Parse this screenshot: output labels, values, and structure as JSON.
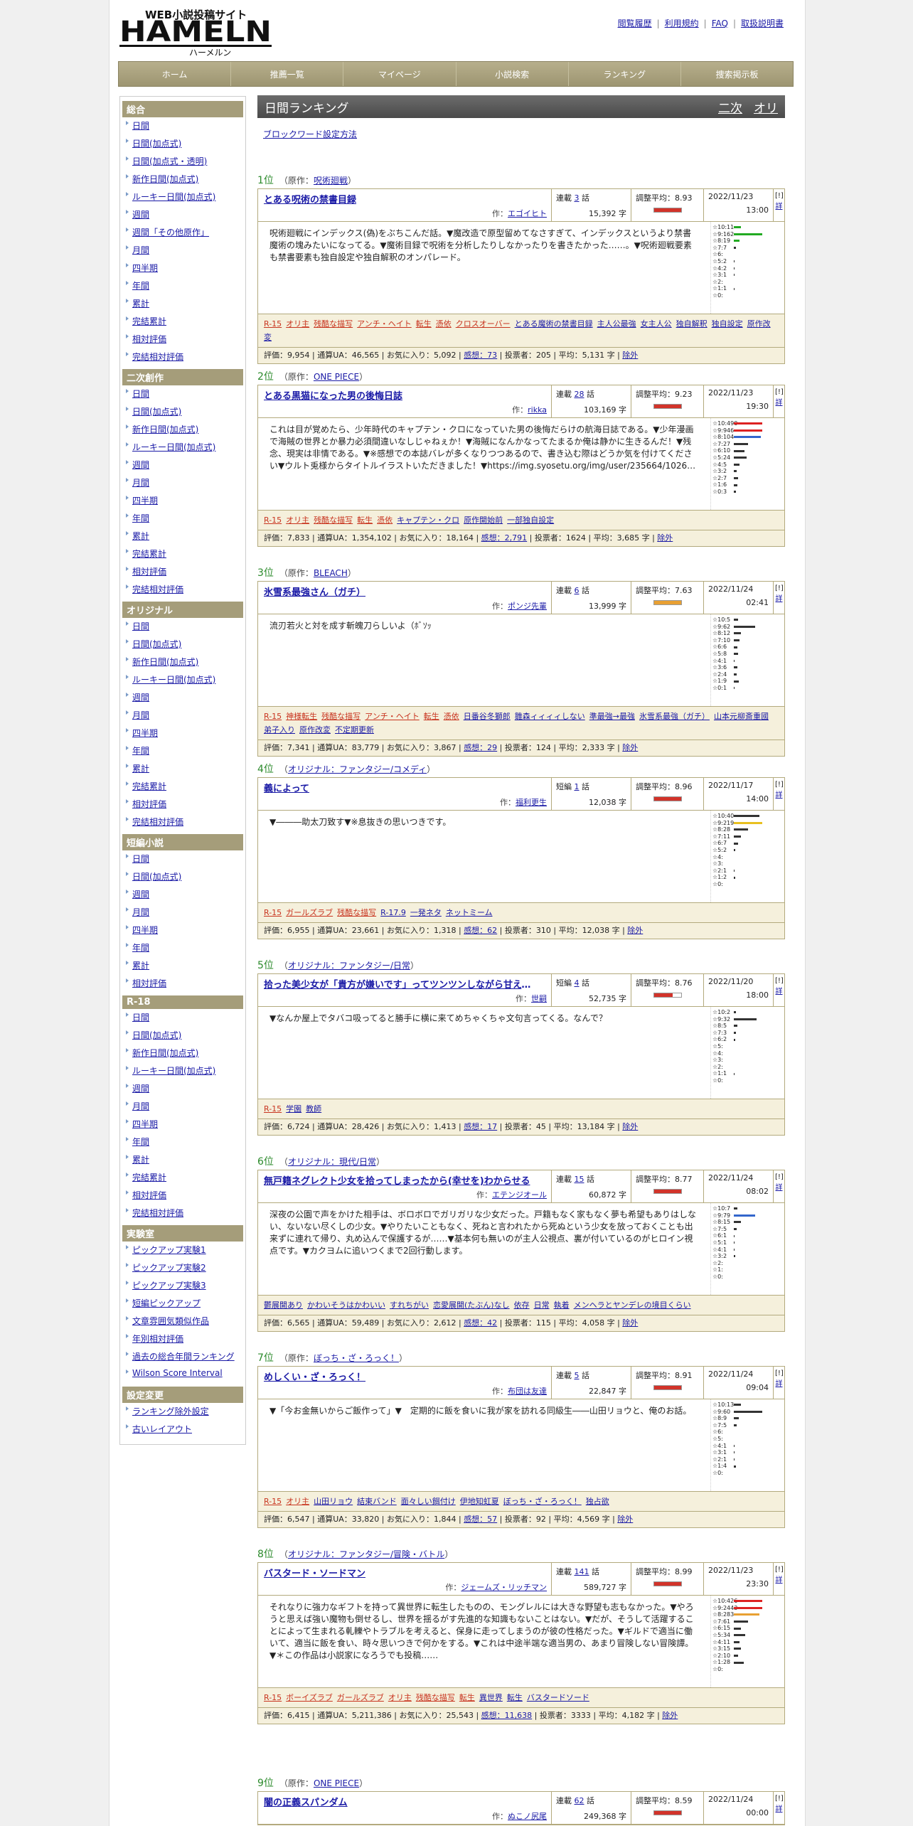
{
  "header": {
    "logo_text": "HAMELN",
    "logo_sub": "WEB小説投稿サイト",
    "logo_kana": "ハーメルン",
    "links": [
      "閲覧履歴",
      "利用規約",
      "FAQ",
      "取扱説明書"
    ]
  },
  "nav": [
    "ホーム",
    "推薦一覧",
    "マイページ",
    "小説検索",
    "ランキング",
    "捜索掲示板"
  ],
  "sidebar": [
    {
      "head": "総合",
      "items": [
        "日間",
        "日間(加点式)",
        "日間(加点式・透明)",
        "新作日間(加点式)",
        "ルーキー日間(加点式)",
        "週間",
        "週間「その他原作」",
        "月間",
        "四半期",
        "年間",
        "累計",
        "完結累計",
        "相対評価",
        "完結相対評価"
      ]
    },
    {
      "head": "二次創作",
      "items": [
        "日間",
        "日間(加点式)",
        "新作日間(加点式)",
        "ルーキー日間(加点式)",
        "週間",
        "月間",
        "四半期",
        "年間",
        "累計",
        "完結累計",
        "相対評価",
        "完結相対評価"
      ]
    },
    {
      "head": "オリジナル",
      "items": [
        "日間",
        "日間(加点式)",
        "新作日間(加点式)",
        "ルーキー日間(加点式)",
        "週間",
        "月間",
        "四半期",
        "年間",
        "累計",
        "完結累計",
        "相対評価",
        "完結相対評価"
      ]
    },
    {
      "head": "短編小説",
      "items": [
        "日間",
        "日間(加点式)",
        "週間",
        "月間",
        "四半期",
        "年間",
        "累計",
        "相対評価"
      ]
    },
    {
      "head": "R-18",
      "items": [
        "日間",
        "日間(加点式)",
        "新作日間(加点式)",
        "ルーキー日間(加点式)",
        "週間",
        "月間",
        "四半期",
        "年間",
        "累計",
        "完結累計",
        "相対評価",
        "完結相対評価"
      ]
    },
    {
      "head": "実験室",
      "items": [
        "ピックアップ実験1",
        "ピックアップ実験2",
        "ピックアップ実験3",
        "短編ピックアップ",
        "文章雰囲気類似作品",
        "年別相対評価",
        "過去の総合年間ランキング",
        "Wilson Score Interval"
      ]
    },
    {
      "head": "設定変更",
      "items": [
        "ランキング除外設定",
        "古いレイアウト"
      ]
    }
  ],
  "ranking": {
    "title": "日間ランキング",
    "tabs": [
      "二次",
      "オリ"
    ],
    "block_link": "ブロックワード設定方法",
    "entries": [
      {
        "rank": "1位",
        "src_prefix": "（原作：",
        "src": "呪術廻戦",
        "src_suffix": "）",
        "title": "とある呪術の禁書目録",
        "author": "エゴイヒト",
        "kind": "連載",
        "eps": "3",
        "chars": "15,392 字",
        "avg": "調整平均：8.93",
        "bar": "#d2332a",
        "bar_fill": 100,
        "date": "2022/11/23",
        "time": "13:00",
        "synopsis": "呪術廻戦にインデックス(偽)をぶちこんだ話。▼魔改造で原型留めてなさすぎて、インデックスというより禁書魔術の塊みたいになってる。▼魔術目録で呪術を分析したりしなかったりを書きたかった……。▼呪術廻戦要素も禁書要素も独自設定や独自解釈のオンパレード。",
        "dist": [
          [
            "☆10:11",
            10,
            "#2a2"
          ],
          [
            "☆9:162",
            40,
            "#2a2"
          ],
          [
            "☆8:19",
            8,
            "#2a2"
          ],
          [
            "☆7:7",
            3,
            "#333"
          ],
          [
            "☆6:",
            0,
            "#333"
          ],
          [
            "☆5:2",
            1,
            "#333"
          ],
          [
            "☆4:2",
            1,
            "#333"
          ],
          [
            "☆3:1",
            1,
            "#333"
          ],
          [
            "☆2:",
            0,
            "#333"
          ],
          [
            "☆1:1",
            1,
            "#333"
          ],
          [
            "☆0:",
            0,
            "#333"
          ]
        ],
        "tags": [
          [
            "R-15",
            1
          ],
          [
            "オリ主",
            1
          ],
          [
            "残酷な描写",
            1
          ],
          [
            "アンチ・ヘイト",
            1
          ],
          [
            "転生",
            1
          ],
          [
            "憑依",
            1
          ],
          [
            "クロスオーバー",
            1
          ],
          [
            "とある魔術の禁書目録",
            0
          ],
          [
            "主人公最強",
            0
          ],
          [
            "女主人公",
            0
          ],
          [
            "独自解釈",
            0
          ],
          [
            "独自設定",
            0
          ],
          [
            "原作改変",
            0
          ]
        ],
        "stats": [
          "評価：9,954",
          "通算UA：46,565",
          "お気に入り：5,092",
          "感想：73",
          "投票者：205",
          "平均：5,131 字",
          "除外"
        ]
      },
      {
        "rank": "2位",
        "src_prefix": "（原作：",
        "src": "ONE PIECE",
        "src_suffix": "）",
        "title": "とある黒猫になった男の後悔日誌",
        "author": "rikka",
        "kind": "連載",
        "eps": "28",
        "chars": "103,169 字",
        "avg": "調整平均：9.23",
        "bar": "#d2332a",
        "bar_fill": 100,
        "date": "2022/11/23",
        "time": "19:30",
        "synopsis": "これは目が覚めたら、少年時代のキャプテン・クロになっていた男の後悔だらけの航海日誌である。▼少年漫画で海賊の世界とか暴力必須間違いなしじゃねぇか！▼海賊になんかなってたまるか俺は静かに生きるんだ！▼残念、現実は非情である。▼※感想での本誌バレが多くなりつつあるので、書き込む際はどうか気を付けてください▼ウルト兎様からタイトルイラストいただきました！▼https://img.syosetu.org/img/user/235664/1026…",
        "dist": [
          [
            "☆10:490",
            40,
            "#d22"
          ],
          [
            "☆9:946",
            40,
            "#d22"
          ],
          [
            "☆8:104",
            38,
            "#36c"
          ],
          [
            "☆7:27",
            20,
            "#333"
          ],
          [
            "☆6:10",
            15,
            "#333"
          ],
          [
            "☆5:24",
            18,
            "#333"
          ],
          [
            "☆4:5",
            8,
            "#333"
          ],
          [
            "☆3:2",
            4,
            "#333"
          ],
          [
            "☆2:7",
            6,
            "#333"
          ],
          [
            "☆1:6",
            5,
            "#333"
          ],
          [
            "☆0:3",
            3,
            "#333"
          ]
        ],
        "tags": [
          [
            "R-15",
            1
          ],
          [
            "オリ主",
            1
          ],
          [
            "残酷な描写",
            1
          ],
          [
            "転生",
            1
          ],
          [
            "憑依",
            1
          ],
          [
            "キャプテン・クロ",
            0
          ],
          [
            "原作開始前",
            0
          ],
          [
            "一部独自設定",
            0
          ]
        ],
        "stats": [
          "評価：7,833",
          "通算UA：1,354,102",
          "お気に入り：18,164",
          "感想：2,791",
          "投票者：1624",
          "平均：3,685 字",
          "除外"
        ]
      },
      {
        "rank": "3位",
        "src_prefix": "（原作：",
        "src": "BLEACH",
        "src_suffix": "）",
        "title": "氷雪系最強さん（ガチ）",
        "author": "ポンジ先輩",
        "kind": "連載",
        "eps": "6",
        "chars": "13,999 字",
        "avg": "調整平均：7.63",
        "bar": "#e8a032",
        "bar_fill": 100,
        "date": "2022/11/24",
        "time": "02:41",
        "synopsis": "流刃若火と対を成す斬魄刀らしいよ（ﾎﾞｿｯ",
        "dist": [
          [
            "☆10:5",
            6,
            "#333"
          ],
          [
            "☆9:62",
            30,
            "#333"
          ],
          [
            "☆8:12",
            10,
            "#333"
          ],
          [
            "☆7:10",
            8,
            "#333"
          ],
          [
            "☆6:6",
            5,
            "#333"
          ],
          [
            "☆5:8",
            6,
            "#333"
          ],
          [
            "☆4:1",
            1,
            "#333"
          ],
          [
            "☆3:6",
            5,
            "#333"
          ],
          [
            "☆2:4",
            4,
            "#333"
          ],
          [
            "☆1:9",
            7,
            "#333"
          ],
          [
            "☆0:1",
            1,
            "#333"
          ]
        ],
        "tags": [
          [
            "R-15",
            1
          ],
          [
            "神様転生",
            1
          ],
          [
            "残酷な描写",
            1
          ],
          [
            "アンチ・ヘイト",
            1
          ],
          [
            "転生",
            1
          ],
          [
            "憑依",
            1
          ],
          [
            "日番谷冬獅郎",
            0
          ],
          [
            "雛森ィィィィしない",
            0
          ],
          [
            "準最強→最強",
            0
          ],
          [
            "氷雪系最強（ガチ）",
            0
          ],
          [
            "山本元柳斎重國",
            0
          ],
          [
            "弟子入り",
            0
          ],
          [
            "原作改変",
            0
          ],
          [
            "不定期更新",
            0
          ]
        ],
        "stats": [
          "評価：7,341",
          "通算UA：83,779",
          "お気に入り：3,867",
          "感想：29",
          "投票者：124",
          "平均：2,333 字",
          "除外"
        ]
      },
      {
        "rank": "4位",
        "src_prefix": "（",
        "src": "オリジナル：ファンタジー/コメディ",
        "src_suffix": "）",
        "title": "義によって",
        "author": "福利更生",
        "kind": "短編",
        "eps": "1",
        "chars": "12,038 字",
        "avg": "調整平均：8.96",
        "bar": "#d2332a",
        "bar_fill": 100,
        "date": "2022/11/17",
        "time": "14:00",
        "synopsis": "▼―――助太刀致す▼※息抜きの思いつきです。",
        "dist": [
          [
            "☆10:40",
            36,
            "#333"
          ],
          [
            "☆9:219",
            40,
            "#e8c020"
          ],
          [
            "☆8:28",
            20,
            "#333"
          ],
          [
            "☆7:11",
            10,
            "#333"
          ],
          [
            "☆6:7",
            6,
            "#333"
          ],
          [
            "☆5:2",
            2,
            "#333"
          ],
          [
            "☆4:",
            0,
            "#333"
          ],
          [
            "☆3:",
            0,
            "#333"
          ],
          [
            "☆2:1",
            1,
            "#333"
          ],
          [
            "☆1:2",
            2,
            "#333"
          ],
          [
            "☆0:",
            0,
            "#333"
          ]
        ],
        "tags": [
          [
            "R-15",
            1
          ],
          [
            "ガールズラブ",
            1
          ],
          [
            "残酷な描写",
            1
          ],
          [
            "R-17.9",
            0
          ],
          [
            "一発ネタ",
            0
          ],
          [
            "ネットミーム",
            0
          ]
        ],
        "stats": [
          "評価：6,955",
          "通算UA：23,661",
          "お気に入り：1,318",
          "感想：62",
          "投票者：310",
          "平均：12,038 字",
          "除外"
        ]
      },
      {
        "rank": "5位",
        "src_prefix": "（",
        "src": "オリジナル：ファンタジー/日常",
        "src_suffix": "）",
        "title": "拾った美少女が「貴方が嫌いです」ってツンツンしながら甘えてくる",
        "author": "世嗣",
        "kind": "短編",
        "eps": "4",
        "chars": "52,735 字",
        "avg": "調整平均：8.76",
        "bar": "#d2332a",
        "bar_fill": 70,
        "date": "2022/11/20",
        "time": "18:00",
        "synopsis": "▼なんか屋上でタバコ吸ってると勝手に横に来てめちゃくちゃ文句言ってくる。なんで？",
        "dist": [
          [
            "☆10:2",
            3,
            "#333"
          ],
          [
            "☆9:32",
            32,
            "#333"
          ],
          [
            "☆8:5",
            5,
            "#333"
          ],
          [
            "☆7:3",
            3,
            "#333"
          ],
          [
            "☆6:2",
            2,
            "#333"
          ],
          [
            "☆5:",
            0,
            "#333"
          ],
          [
            "☆4:",
            0,
            "#333"
          ],
          [
            "☆3:",
            0,
            "#333"
          ],
          [
            "☆2:",
            0,
            "#333"
          ],
          [
            "☆1:1",
            1,
            "#333"
          ],
          [
            "☆0:",
            0,
            "#333"
          ]
        ],
        "tags": [
          [
            "R-15",
            1
          ],
          [
            "学園",
            0
          ],
          [
            "教師",
            0
          ]
        ],
        "stats": [
          "評価：6,724",
          "通算UA：28,426",
          "お気に入り：1,413",
          "感想：17",
          "投票者：45",
          "平均：13,184 字",
          "除外"
        ]
      },
      {
        "rank": "6位",
        "src_prefix": "（",
        "src": "オリジナル：現代/日常",
        "src_suffix": "）",
        "title": "無戸籍ネグレクト少女を拾ってしまったから(幸せを)わからせる",
        "author": "エテンジオール",
        "kind": "連載",
        "eps": "15",
        "chars": "60,872 字",
        "avg": "調整平均：8.77",
        "bar": "#d2332a",
        "bar_fill": 100,
        "date": "2022/11/24",
        "time": "08:02",
        "synopsis": "深夜の公園で声をかけた相手は、ボロボロでガリガリな少女だった。戸籍もなく家もなく夢も希望もありはしない、ないない尽くしの少女。▼やりたいこともなく、死ねと言われたから死ぬという少女を放っておくことも出来ずに連れて帰り、丸め込んで保護するが……▼基本何も無いのが主人公視点、裏が付いているのがヒロイン視点です。▼カクヨムに追いつくまで2回行動します。",
        "dist": [
          [
            "☆10:7",
            5,
            "#333"
          ],
          [
            "☆9:79",
            30,
            "#36c"
          ],
          [
            "☆8:15",
            10,
            "#333"
          ],
          [
            "☆7:5",
            4,
            "#333"
          ],
          [
            "☆6:1",
            1,
            "#333"
          ],
          [
            "☆5:1",
            1,
            "#333"
          ],
          [
            "☆4:1",
            1,
            "#333"
          ],
          [
            "☆3:2",
            2,
            "#333"
          ],
          [
            "☆2:",
            0,
            "#333"
          ],
          [
            "☆1:",
            0,
            "#333"
          ],
          [
            "☆0:",
            0,
            "#333"
          ]
        ],
        "tags": [
          [
            "鬱展開あり",
            0
          ],
          [
            "かわいそうはかわいい",
            0
          ],
          [
            "すれちがい",
            0
          ],
          [
            "恋愛展開(たぶん)なし",
            0
          ],
          [
            "依存",
            0
          ],
          [
            "日常",
            0
          ],
          [
            "執着",
            0
          ],
          [
            "メンヘラとヤンデレの境目くらい",
            0
          ]
        ],
        "stats": [
          "評価：6,565",
          "通算UA：59,489",
          "お気に入り：2,612",
          "感想：42",
          "投票者：115",
          "平均：4,058 字",
          "除外"
        ]
      },
      {
        "rank": "7位",
        "src_prefix": "（原作：",
        "src": "ぼっち・ざ・ろっく！",
        "src_suffix": "）",
        "title": "めしくい・ざ・ろっく！",
        "author": "布団は友達",
        "kind": "連載",
        "eps": "5",
        "chars": "22,847 字",
        "avg": "調整平均：8.91",
        "bar": "#d2332a",
        "bar_fill": 100,
        "date": "2022/11/24",
        "time": "09:04",
        "synopsis": "▼「今お金無いからご飯作って」▼　定期的に飯を食いに我が家を訪れる同級生――山田リョウと、俺のお話。",
        "dist": [
          [
            "☆10:13",
            10,
            "#333"
          ],
          [
            "☆9:60",
            40,
            "#333"
          ],
          [
            "☆8:9",
            7,
            "#333"
          ],
          [
            "☆7:5",
            4,
            "#333"
          ],
          [
            "☆6:",
            0,
            "#333"
          ],
          [
            "☆5:",
            0,
            "#333"
          ],
          [
            "☆4:1",
            1,
            "#333"
          ],
          [
            "☆3:1",
            1,
            "#333"
          ],
          [
            "☆2:1",
            1,
            "#333"
          ],
          [
            "☆1:4",
            3,
            "#333"
          ],
          [
            "☆0:",
            0,
            "#333"
          ]
        ],
        "tags": [
          [
            "R-15",
            1
          ],
          [
            "オリ主",
            1
          ],
          [
            "山田リョウ",
            0
          ],
          [
            "結束バンド",
            0
          ],
          [
            "面々しい餌付け",
            0
          ],
          [
            "伊地知虹夏",
            0
          ],
          [
            "ぼっち・ざ・ろっく！",
            0
          ],
          [
            "独占欲",
            0
          ]
        ],
        "stats": [
          "評価：6,547",
          "通算UA：33,820",
          "お気に入り：1,844",
          "感想：57",
          "投票者：92",
          "平均：4,569 字",
          "除外"
        ]
      },
      {
        "rank": "8位",
        "src_prefix": "（",
        "src": "オリジナル：ファンタジー/冒険・バトル",
        "src_suffix": "）",
        "title": "バスタード・ソードマン",
        "author": "ジェームズ・リッチマン",
        "kind": "連載",
        "eps": "141",
        "chars": "589,727 字",
        "avg": "調整平均：8.99",
        "bar": "#d2332a",
        "bar_fill": 100,
        "date": "2022/11/23",
        "time": "23:30",
        "synopsis": "それなりに強力なギフトを持って異世界に転生したものの、モングレルには大きな野望も志もなかった。▼やろうと思えば強い魔物も倒せるし、世界を揺るがす先進的な知識もないことはない。▼だが、そうして活躍することによって生まれる軋轢やトラブルを考えると、保身に走ってしまうのが彼の性格だった。▼ギルドで適当に働いて、適当に飯を食い、時々思いつきで何かをする。▼これは中途半端な適当男の、あまり冒険しない冒険譚。▼＊この作品は小説家になろうでも投稿……",
        "dist": [
          [
            "☆10:426",
            40,
            "#d22"
          ],
          [
            "☆9:2443",
            40,
            "#d22"
          ],
          [
            "☆8:283",
            36,
            "#e8a032"
          ],
          [
            "☆7:61",
            20,
            "#333"
          ],
          [
            "☆6:15",
            10,
            "#333"
          ],
          [
            "☆5:34",
            16,
            "#333"
          ],
          [
            "☆4:11",
            8,
            "#333"
          ],
          [
            "☆3:15",
            10,
            "#333"
          ],
          [
            "☆2:10",
            6,
            "#333"
          ],
          [
            "☆1:28",
            14,
            "#333"
          ],
          [
            "☆0:",
            0,
            "#333"
          ]
        ],
        "tags": [
          [
            "R-15",
            1
          ],
          [
            "ボーイズラブ",
            1
          ],
          [
            "ガールズラブ",
            1
          ],
          [
            "オリ主",
            1
          ],
          [
            "残酷な描写",
            1
          ],
          [
            "転生",
            1
          ],
          [
            "異世界",
            0
          ],
          [
            "転生",
            0
          ],
          [
            "バスタードソード",
            0
          ]
        ],
        "stats": [
          "評価：6,415",
          "通算UA：5,211,386",
          "お気に入り：25,543",
          "感想：11,638",
          "投票者：3333",
          "平均：4,182 字",
          "除外"
        ]
      },
      {
        "rank": "9位",
        "src_prefix": "（原作：",
        "src": "ONE PIECE",
        "src_suffix": "）",
        "title": "闇の正義スパンダム",
        "author": "ぬこノ尻尾",
        "kind": "連載",
        "eps": "62",
        "chars": "249,368 字",
        "avg": "調整平均：8.59",
        "bar": "#d2332a",
        "bar_fill": 100,
        "date": "2022/11/24",
        "time": "00:00",
        "synopsis": "",
        "dist": [],
        "tags": [],
        "stats": []
      }
    ]
  },
  "labels": {
    "by": "作：",
    "ep_unit": "話",
    "ext": "[!]",
    "detail": "詳"
  }
}
